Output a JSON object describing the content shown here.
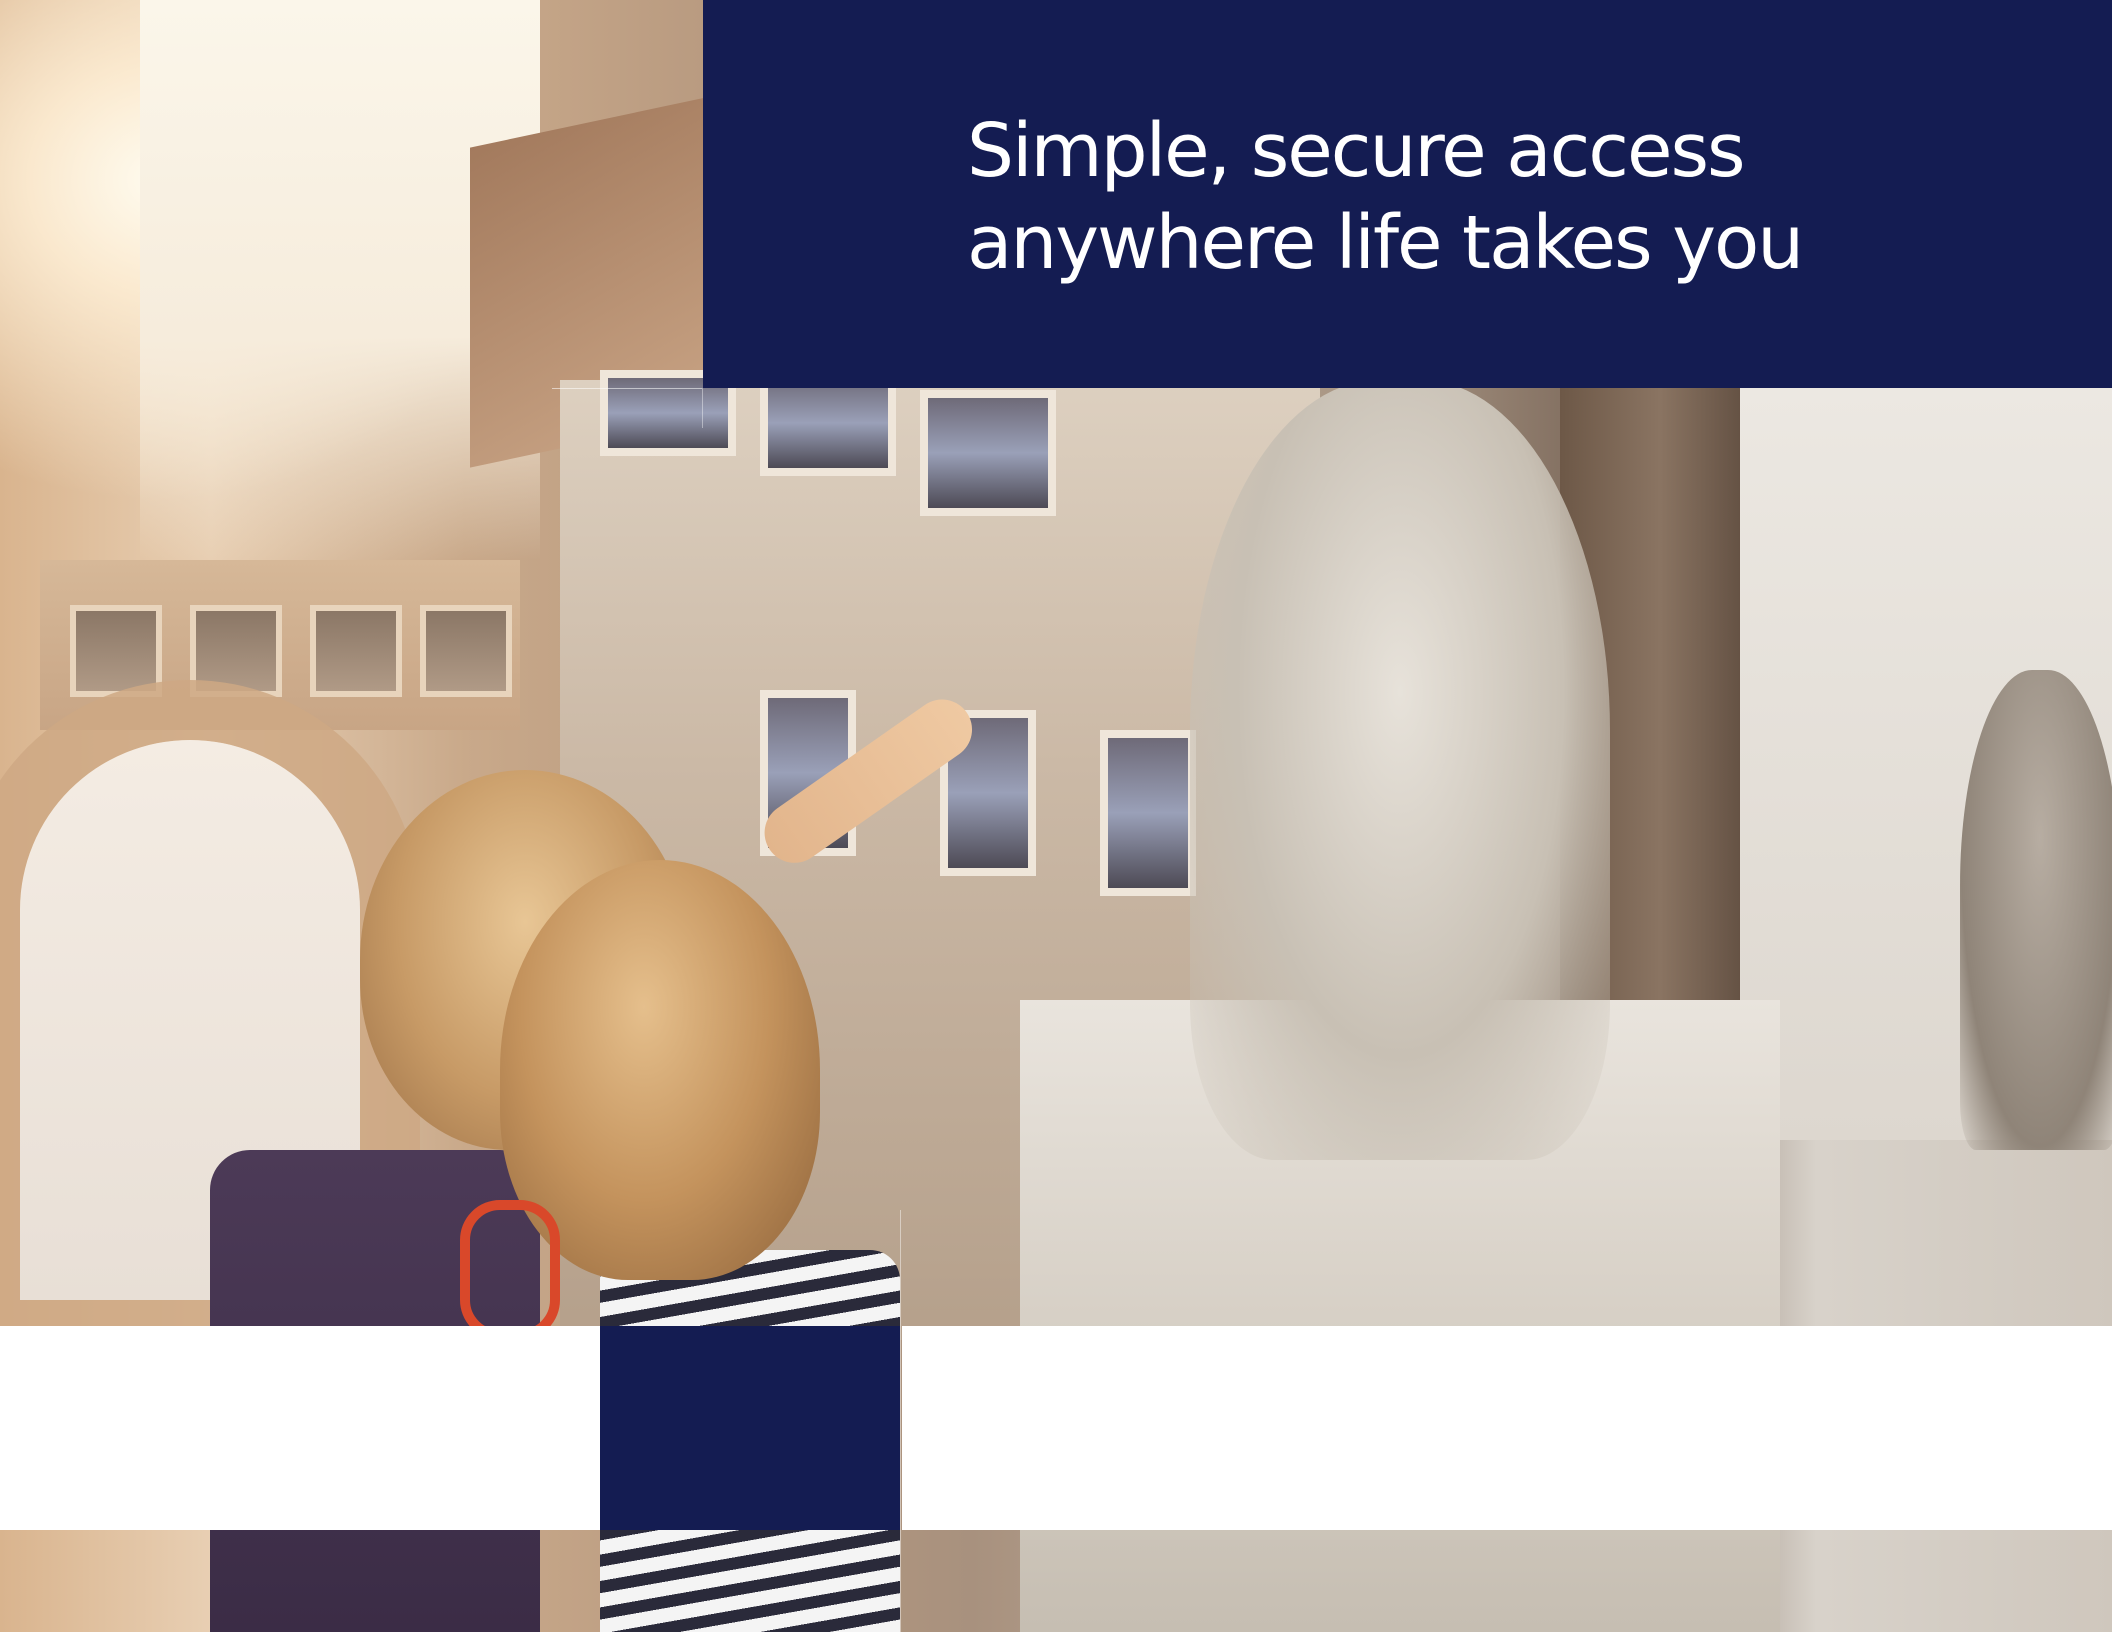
{
  "hero": {
    "headline_line1": "Simple, secure access",
    "headline_line2": "anywhere life takes you"
  },
  "colors": {
    "brand_navy": "#141c52",
    "text_on_navy": "#ffffff",
    "band_white": "#ffffff"
  }
}
